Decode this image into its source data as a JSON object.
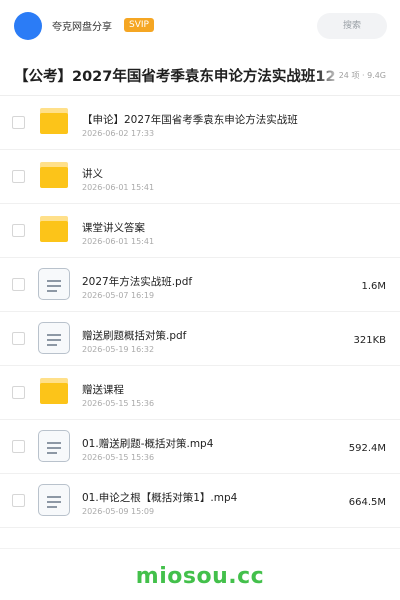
{
  "header": {
    "share_name": "夸克网盘分享",
    "badge": "SVIP",
    "search_label": "搜索",
    "colors": {
      "avatar": "#2b7cf6",
      "badge": "#f5a623"
    }
  },
  "folder": {
    "title": "【公考】2027年国省考季袁东申论方法实战班12",
    "meta": "24 项 · 9.4G"
  },
  "files": [
    {
      "type": "folder",
      "icon": "folder-icon",
      "name": "【申论】2027年国省考季袁东申论方法实战班",
      "date": "2026-06-02 17:33",
      "size": ""
    },
    {
      "type": "folder",
      "icon": "folder-icon",
      "name": "讲义",
      "date": "2026-06-01 15:41",
      "size": ""
    },
    {
      "type": "folder",
      "icon": "folder-icon",
      "name": "课堂讲义答案",
      "date": "2026-06-01 15:41",
      "size": ""
    },
    {
      "type": "file",
      "icon": "document-icon",
      "name": "2027年方法实战班.pdf",
      "date": "2026-05-07 16:19",
      "size": "1.6M"
    },
    {
      "type": "file",
      "icon": "document-icon",
      "name": "赠送刷题概括对策.pdf",
      "date": "2026-05-19 16:32",
      "size": "321KB"
    },
    {
      "type": "folder",
      "icon": "folder-icon",
      "name": "赠送课程",
      "date": "2026-05-15 15:36",
      "size": ""
    },
    {
      "type": "file",
      "icon": "document-icon",
      "name": "01.赠送刷题-概括对策.mp4",
      "date": "2026-05-15 15:36",
      "size": "592.4M"
    },
    {
      "type": "file",
      "icon": "document-icon",
      "name": "01.申论之根【概括对策1】.mp4",
      "date": "2026-05-09 15:09",
      "size": "664.5M"
    }
  ],
  "footer": {
    "brand": "miosou.cc",
    "color": "#43c04b"
  }
}
